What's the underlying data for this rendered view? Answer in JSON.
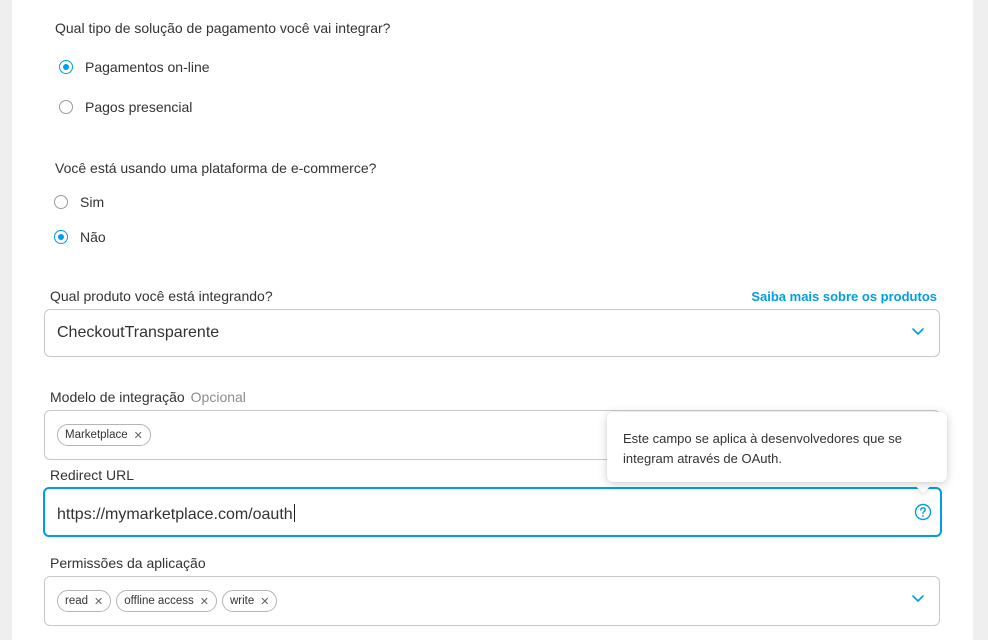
{
  "payment_question": {
    "label": "Qual tipo de solução de pagamento você vai integrar?",
    "options": [
      {
        "label": "Pagamentos on-line",
        "selected": true
      },
      {
        "label": "Pagos presencial",
        "selected": false
      }
    ]
  },
  "ecommerce_question": {
    "label": "Você está usando uma plataforma de e-commerce?",
    "options": [
      {
        "label": "Sim",
        "selected": false
      },
      {
        "label": "Não",
        "selected": true
      }
    ]
  },
  "product": {
    "label": "Qual produto você está integrando?",
    "link": "Saiba mais sobre os produtos",
    "value": "CheckoutTransparente"
  },
  "integration_model": {
    "label": "Modelo de integração",
    "optional": "Opcional",
    "chips": [
      "Marketplace"
    ]
  },
  "tooltip": {
    "text": "Este campo se aplica à desenvolvedores que se integram através de OAuth."
  },
  "redirect": {
    "label": "Redirect URL",
    "value": "https://mymarketplace.com/oauth"
  },
  "permissions": {
    "label": "Permissões da aplicação",
    "chips": [
      "read",
      "offline access",
      "write"
    ]
  },
  "colors": {
    "accent": "#009ee3",
    "text": "#333333",
    "muted": "#8c8c8c",
    "border": "#c8c8c8"
  }
}
